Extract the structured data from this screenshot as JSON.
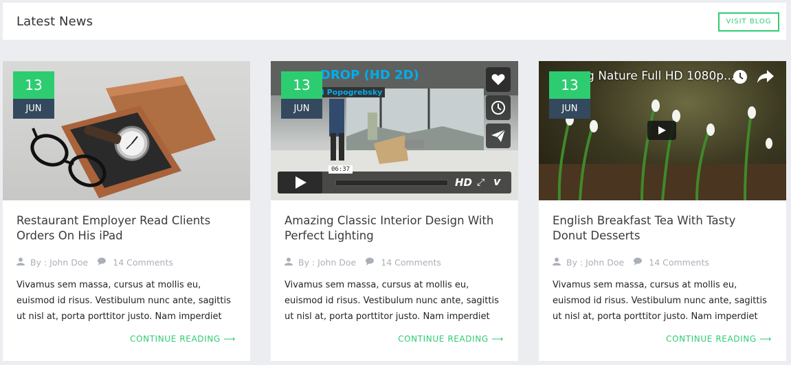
{
  "header": {
    "title": "Latest News",
    "visit_label": "VISIT BLOG"
  },
  "cards": [
    {
      "date": {
        "day": "13",
        "month": "JUN"
      },
      "title": "Restaurant Employer Read Clients Orders On His iPad",
      "author": "By : John Doe",
      "comments": "14 Comments",
      "excerpt": "Vivamus sem massa, cursus at mollis eu, euismod id risus. Vestibulum nunc ante, sagittis ut nisl at, porta porttitor justo. Nam imperdiet",
      "continue": "CONTINUE READING"
    },
    {
      "date": {
        "day": "13",
        "month": "JUN"
      },
      "title": "Amazing Classic Interior Design With Perfect Lighting",
      "author": "By : John Doe",
      "comments": "14 Comments",
      "excerpt": "Vivamus sem massa, cursus at mollis eu, euismod id risus. Vestibulum nunc ante, sagittis ut nisl at, porta porttitor justo. Nam imperdiet",
      "continue": "CONTINUE READING",
      "video": {
        "title": "DROP (HD 2D)",
        "byline": "i Popogrebsky",
        "time": "06:37",
        "hd": "HD"
      }
    },
    {
      "date": {
        "day": "13",
        "month": "JUN"
      },
      "title": "English Breakfast Tea With Tasty Donut Desserts",
      "author": "By : John Doe",
      "comments": "14 Comments",
      "excerpt": "Vivamus sem massa, cursus at mollis eu, euismod id risus. Vestibulum nunc ante, sagittis ut nisl at, porta porttitor justo. Nam imperdiet",
      "continue": "CONTINUE READING",
      "video": {
        "title": "g Nature Full HD 1080p..."
      }
    }
  ],
  "colors": {
    "accent": "#2ecc71",
    "dark": "#34495e",
    "background": "#ebedf1"
  }
}
